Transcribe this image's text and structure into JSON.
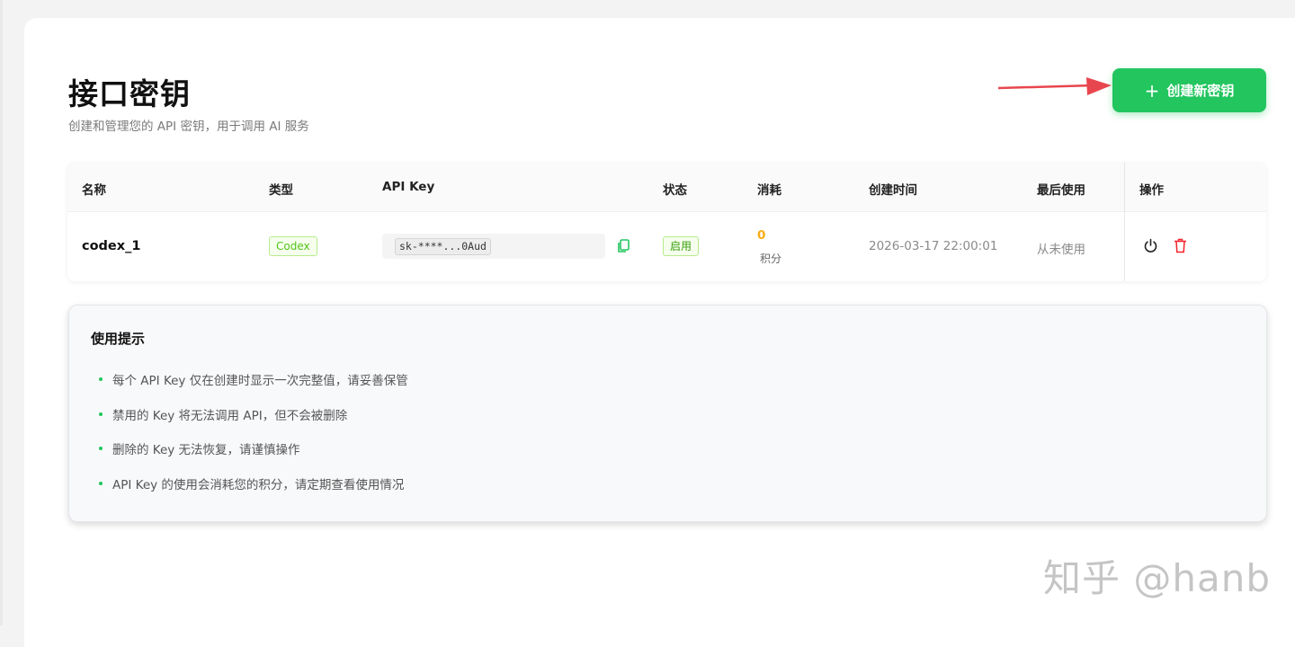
{
  "header": {
    "title": "接口密钥",
    "subtitle": "创建和管理您的 API 密钥，用于调用 AI 服务",
    "create_button_label": "创建新密钥"
  },
  "table": {
    "columns": [
      "名称",
      "类型",
      "API Key",
      "状态",
      "消耗",
      "创建时间",
      "最后使用",
      "操作"
    ],
    "rows": [
      {
        "name": "codex_1",
        "type": "Codex",
        "api_key": "sk-****...0Aud",
        "status": "启用",
        "usage": "0",
        "usage_unit": "积分",
        "created_at": "2026-03-17 22:00:01",
        "last_used": "从未使用"
      }
    ]
  },
  "tips": {
    "title": "使用提示",
    "items": [
      "每个 API Key 仅在创建时显示一次完整值，请妥善保管",
      "禁用的 Key 将无法调用 API，但不会被删除",
      "删除的 Key 无法恢复，请谨慎操作",
      "API Key 的使用会消耗您的积分，请定期查看使用情况"
    ]
  },
  "watermark": "知乎 @hanb",
  "colors": {
    "accent": "#22c55e",
    "tag_border": "#b7eb8f",
    "tag_bg": "#f6ffed",
    "usage": "#faad14",
    "delete": "#f5222d",
    "annotation_arrow": "#e8464e"
  },
  "icons": {
    "create": "plus-icon",
    "copy": "copy-icon",
    "toggle": "power-icon",
    "delete": "trash-icon"
  }
}
